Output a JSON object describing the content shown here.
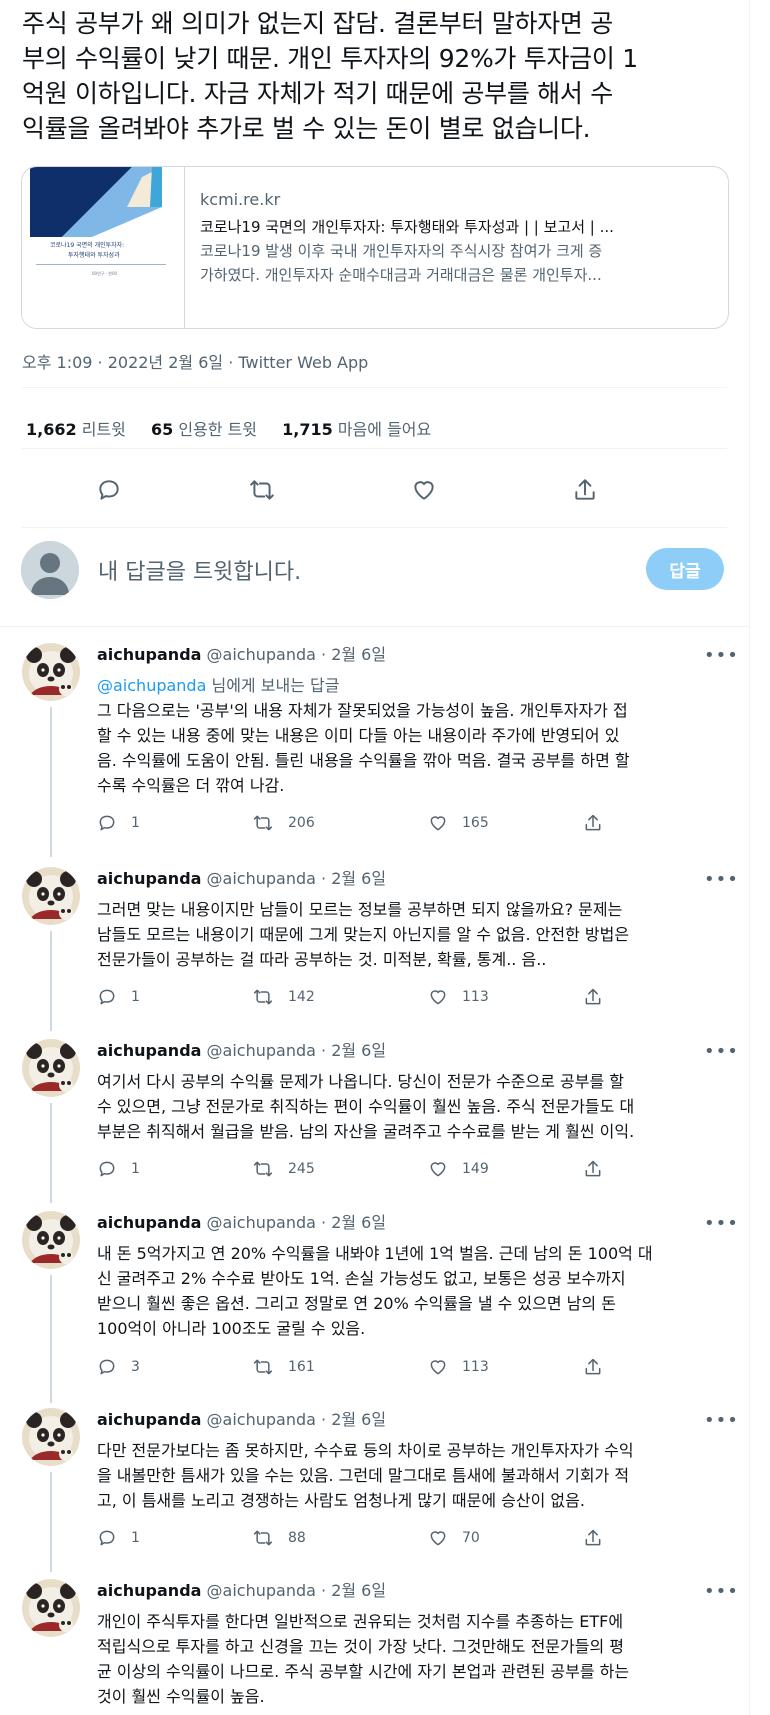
{
  "main_tweet": {
    "text_lines": [
      "주식 공부가 왜 의미가 없는지 잡담. 결론부터 말하자면 공",
      "부의 수익률이 낮기 때문. 개인 투자자의 92%가 투자금이 1",
      "억원 이하입니다. 자금 자체가 적기 때문에 공부를 해서 수",
      "익률을 올려봐야 추가로 벌 수 있는 돈이 별로 없습니다."
    ],
    "card": {
      "thumb_text1": "코로나19 국면의 개인투자자:",
      "thumb_text2": "투자행태와 투자성과",
      "thumb_text3": "00연구 · 한00",
      "domain": "kcmi.re.kr",
      "title": "코로나19 국면의 개인투자자: 투자행태와 투자성과 | | 보고서 | ...",
      "desc_line1": "코로나19 발생 이후 국내 개인투자자의 주식시장 참여가 크게 증",
      "desc_line2": "가하였다. 개인투자자 순매수대금과 거래대금은 물론 개인투자..."
    },
    "meta": "오후 1:09 · 2022년 2월 6일 · Twitter Web App",
    "stats": {
      "retweets_count": "1,662",
      "retweets_label": "리트윗",
      "quotes_count": "65",
      "quotes_label": "인용한 트윗",
      "likes_count": "1,715",
      "likes_label": "마음에 들어요"
    },
    "action_icons": [
      "reply-icon",
      "retweet-icon",
      "like-icon",
      "share-icon"
    ]
  },
  "reply_box": {
    "placeholder": "내 답글을 트윗합니다.",
    "button": "답글"
  },
  "replies": [
    {
      "name": "aichupanda",
      "handle": "@aichupanda",
      "date": "· 2월 6일",
      "reply_to_mention": "@aichupanda",
      "reply_to_suffix": " 님에게 보내는 답글",
      "lines": [
        "그 다음으로는 '공부'의 내용 자체가 잘못되었을 가능성이 높음. 개인투자자가 접",
        "할 수 있는 내용 중에 맞는 내용은 이미 다들 아는 내용이라 주가에 반영되어 있",
        "음. 수익률에 도움이 안됨. 틀린 내용을 수익률을 깎아 먹음. 결국 공부를 하면 할",
        "수록 수익률은 더 깎여 나감."
      ],
      "replies": "1",
      "retweets": "206",
      "likes": "165"
    },
    {
      "name": "aichupanda",
      "handle": "@aichupanda",
      "date": "· 2월 6일",
      "lines": [
        "그러면 맞는 내용이지만 남들이 모르는 정보를 공부하면 되지 않을까요? 문제는",
        "남들도 모르는 내용이기 때문에 그게 맞는지 아닌지를 알 수 없음. 안전한 방법은",
        "전문가들이 공부하는 걸 따라 공부하는 것. 미적분, 확률, 통계.. 음.."
      ],
      "replies": "1",
      "retweets": "142",
      "likes": "113"
    },
    {
      "name": "aichupanda",
      "handle": "@aichupanda",
      "date": "· 2월 6일",
      "lines": [
        "여기서 다시 공부의 수익률 문제가 나옵니다. 당신이 전문가 수준으로 공부를 할",
        "수 있으면, 그냥 전문가로 취직하는 편이 수익률이 훨씬 높음. 주식 전문가들도 대",
        "부분은 취직해서 월급을 받음. 남의 자산을 굴려주고 수수료를 받는 게 훨씬 이익."
      ],
      "replies": "1",
      "retweets": "245",
      "likes": "149"
    },
    {
      "name": "aichupanda",
      "handle": "@aichupanda",
      "date": "· 2월 6일",
      "lines": [
        "내 돈 5억가지고 연 20% 수익률을 내봐야 1년에 1억 벌음. 근데 남의 돈 100억 대",
        "신 굴려주고 2% 수수료 받아도 1억. 손실 가능성도 없고, 보통은 성공 보수까지",
        "받으니 훨씬 좋은 옵션. 그리고 정말로 연 20% 수익률을 낼 수 있으면 남의 돈",
        "100억이 아니라 100조도 굴릴 수 있음."
      ],
      "replies": "3",
      "retweets": "161",
      "likes": "113"
    },
    {
      "name": "aichupanda",
      "handle": "@aichupanda",
      "date": "· 2월 6일",
      "lines": [
        "다만 전문가보다는 좀 못하지만, 수수료 등의 차이로 공부하는 개인투자자가 수익",
        "을 내볼만한 틈새가 있을 수는 있음. 그런데 말그대로 틈새에 불과해서 기회가 적",
        "고, 이 틈새를 노리고 경쟁하는 사람도 엄청나게 많기 때문에 승산이 없음."
      ],
      "replies": "1",
      "retweets": "88",
      "likes": "70"
    },
    {
      "name": "aichupanda",
      "handle": "@aichupanda",
      "date": "· 2월 6일",
      "lines": [
        "개인이 주식투자를 한다면 일반적으로 권유되는 것처럼 지수를 추종하는 ETF에",
        "적립식으로 투자를 하고 신경을 끄는 것이 가장 낫다. 그것만해도 전문가들의 평",
        "균 이상의 수익률이 나므로. 주식 공부할 시간에 자기 본업과 관련된 공부를 하는",
        "것이 훨씬 수익률이 높음."
      ]
    }
  ],
  "colors": {
    "accent": "#1d9bf0",
    "secondary_text": "#536471",
    "reply_button": "#8ecdf8"
  }
}
